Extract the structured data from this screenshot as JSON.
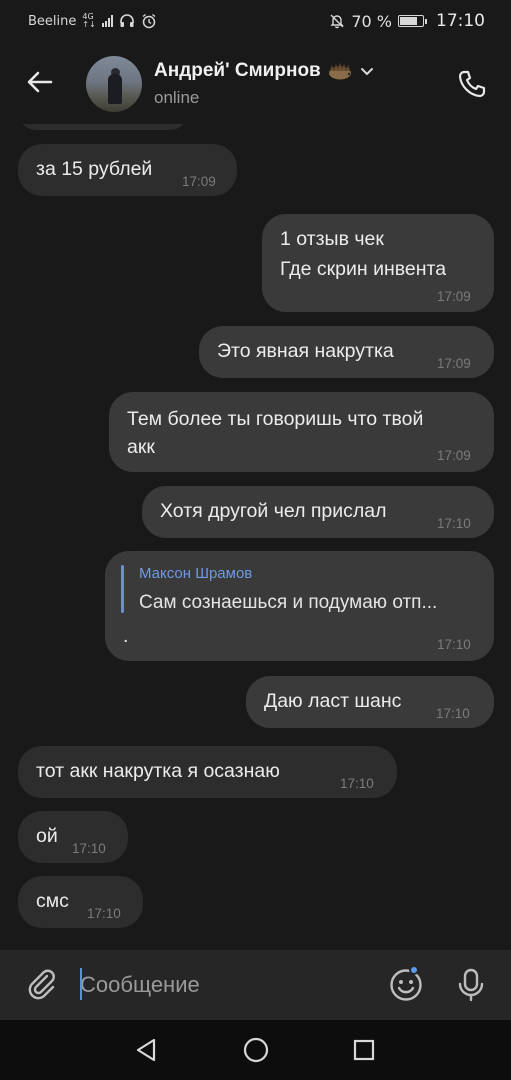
{
  "status_bar": {
    "carrier": "Beeline",
    "network_type": "4G",
    "battery_percent": "70 %",
    "battery_level": 0.7,
    "time": "17:10"
  },
  "header": {
    "peer_name": "Андрей' Смирнов",
    "peer_status": "online"
  },
  "messages": [
    {
      "direction": "in",
      "text": "за 15 рублей",
      "time": "17:09"
    },
    {
      "direction": "out",
      "lines": [
        "1 отзыв чек",
        "Где скрин инвента"
      ],
      "time": "17:09"
    },
    {
      "direction": "out",
      "text": "Это явная накрутка",
      "time": "17:09"
    },
    {
      "direction": "out",
      "lines": [
        "Тем более ты говоришь что твой",
        "акк"
      ],
      "time": "17:09"
    },
    {
      "direction": "out",
      "text": "Хотя другой чел прислал",
      "time": "17:10"
    },
    {
      "direction": "out",
      "reply_author": "Максон Шрамов",
      "reply_text": "Сам сознаешься и подумаю отп...",
      "text": ".",
      "time": "17:10"
    },
    {
      "direction": "out",
      "text": "Даю ласт шанс",
      "time": "17:10"
    },
    {
      "direction": "in",
      "text": "тот акк накрутка я осазнаю",
      "time": "17:10"
    },
    {
      "direction": "in",
      "text": "ой",
      "time": "17:10"
    },
    {
      "direction": "in",
      "text": "смс",
      "time": "17:10"
    }
  ],
  "composer": {
    "placeholder": "Сообщение"
  },
  "colors": {
    "background": "#191919",
    "bubble_in": "#2d2d2e",
    "bubble_out": "#3a3a3b",
    "accent": "#6f9ae0",
    "composer_bg": "#262627"
  },
  "icons": [
    "back-arrow-icon",
    "chevron-down-icon",
    "phone-icon",
    "paperclip-icon",
    "sticker-smile-icon",
    "microphone-icon",
    "nav-back-icon",
    "nav-home-icon",
    "nav-recents-icon",
    "hedgehog-emoji-icon"
  ]
}
